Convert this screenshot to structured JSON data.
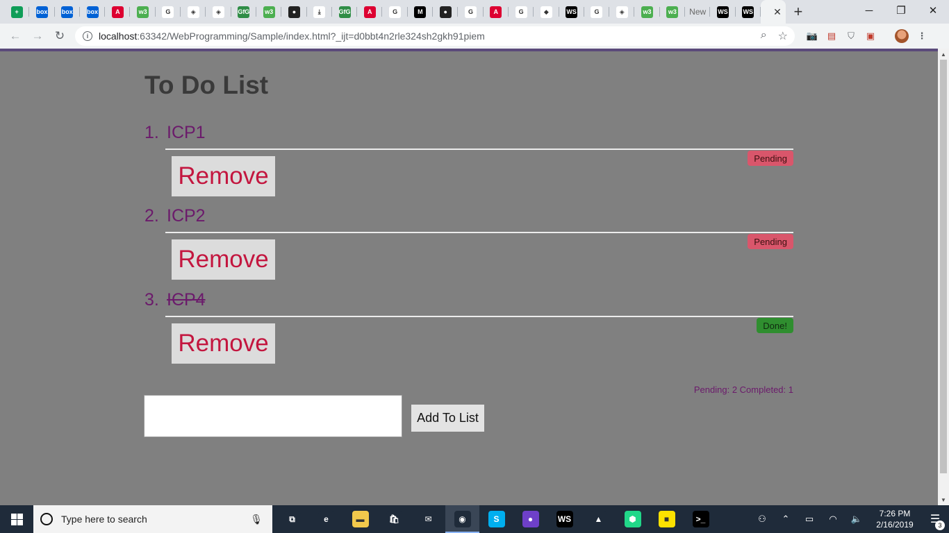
{
  "browser": {
    "tabs": [
      {
        "icon": "sheets-icon",
        "label": "",
        "color": "#0f9d58",
        "glyph": "+"
      },
      {
        "icon": "box-icon",
        "label": "",
        "color": "#0061d5",
        "glyph": "box"
      },
      {
        "icon": "box-icon",
        "label": "",
        "color": "#0061d5",
        "glyph": "box"
      },
      {
        "icon": "box-icon",
        "label": "",
        "color": "#0061d5",
        "glyph": "box"
      },
      {
        "icon": "angular-icon",
        "label": "",
        "color": "#dd0031",
        "glyph": "A"
      },
      {
        "icon": "w3schools-icon",
        "label": "",
        "color": "#4caf50",
        "glyph": "w3"
      },
      {
        "icon": "google-icon",
        "label": "",
        "color": "#ffffff",
        "glyph": "G"
      },
      {
        "icon": "codepen-icon",
        "label": "",
        "color": "#ffffff",
        "glyph": "◈"
      },
      {
        "icon": "codepen-icon",
        "label": "",
        "color": "#ffffff",
        "glyph": "◈"
      },
      {
        "icon": "gfg-icon",
        "label": "",
        "color": "#2f8d46",
        "glyph": "GfG"
      },
      {
        "icon": "w3schools-icon",
        "label": "",
        "color": "#4caf50",
        "glyph": "w3"
      },
      {
        "icon": "github-icon",
        "label": "",
        "color": "#222222",
        "glyph": "●"
      },
      {
        "icon": "download-icon",
        "label": "",
        "color": "#ffffff",
        "glyph": "⤓"
      },
      {
        "icon": "gfg-icon",
        "label": "",
        "color": "#2f8d46",
        "glyph": "GfG"
      },
      {
        "icon": "angular-icon",
        "label": "",
        "color": "#dd0031",
        "glyph": "A"
      },
      {
        "icon": "google-icon",
        "label": "",
        "color": "#ffffff",
        "glyph": "G"
      },
      {
        "icon": "medium-icon",
        "label": "",
        "color": "#000000",
        "glyph": "M"
      },
      {
        "icon": "github-icon",
        "label": "",
        "color": "#222222",
        "glyph": "●"
      },
      {
        "icon": "google-icon",
        "label": "",
        "color": "#ffffff",
        "glyph": "G"
      },
      {
        "icon": "angular-icon",
        "label": "",
        "color": "#dd0031",
        "glyph": "A"
      },
      {
        "icon": "google-icon",
        "label": "",
        "color": "#ffffff",
        "glyph": "G"
      },
      {
        "icon": "scrum-icon",
        "label": "",
        "color": "#ffffff",
        "glyph": "◆"
      },
      {
        "icon": "webstorm-icon",
        "label": "",
        "color": "#000000",
        "glyph": "WS"
      },
      {
        "icon": "google-icon",
        "label": "",
        "color": "#ffffff",
        "glyph": "G"
      },
      {
        "icon": "codepen-icon",
        "label": "",
        "color": "#ffffff",
        "glyph": "◈"
      },
      {
        "icon": "w3schools-icon",
        "label": "",
        "color": "#4caf50",
        "glyph": "w3"
      },
      {
        "icon": "w3schools-icon",
        "label": "",
        "color": "#4caf50",
        "glyph": "w3"
      },
      {
        "icon": "newtab-icon",
        "label": "New",
        "color": "",
        "glyph": ""
      },
      {
        "icon": "webstorm-icon",
        "label": "",
        "color": "#000000",
        "glyph": "WS"
      },
      {
        "icon": "webstorm-icon",
        "label": "",
        "color": "#000000",
        "glyph": "WS"
      }
    ],
    "url_host": "localhost",
    "url_path": ":63342/WebProgramming/Sample/index.html?_ijt=d0bbt4n2rle324sh2gkh91piem"
  },
  "app": {
    "title": "To Do List",
    "items": [
      {
        "number": "1.",
        "text": "ICP1",
        "status": "Pending",
        "done": false,
        "remove_label": "Remove"
      },
      {
        "number": "2.",
        "text": "ICP2",
        "status": "Pending",
        "done": false,
        "remove_label": "Remove"
      },
      {
        "number": "3.",
        "text": "ICP4",
        "status": "Done!",
        "done": true,
        "remove_label": "Remove"
      }
    ],
    "counts": "Pending: 2 Completed: 1",
    "input_value": "",
    "add_label": "Add To List"
  },
  "taskbar": {
    "search_placeholder": "Type here to search",
    "time": "7:26 PM",
    "date": "2/16/2019",
    "notification_count": "3",
    "apps": [
      {
        "icon": "task-view-icon",
        "color": "#1f2b3a",
        "glyph": "⧉"
      },
      {
        "icon": "edge-icon",
        "color": "#1f2b3a",
        "glyph": "e"
      },
      {
        "icon": "file-explorer-icon",
        "color": "#f2c94c",
        "glyph": "▬"
      },
      {
        "icon": "store-icon",
        "color": "#1f2b3a",
        "glyph": "🛍"
      },
      {
        "icon": "mail-icon",
        "color": "#1f2b3a",
        "glyph": "✉"
      },
      {
        "icon": "chrome-icon",
        "color": "#1f2b3a",
        "glyph": "◉"
      },
      {
        "icon": "skype-icon",
        "color": "#00aff0",
        "glyph": "S"
      },
      {
        "icon": "github-desktop-icon",
        "color": "#6e40c9",
        "glyph": "●"
      },
      {
        "icon": "webstorm-icon",
        "color": "#000000",
        "glyph": "WS"
      },
      {
        "icon": "sharkdoc-icon",
        "color": "#1f2b3a",
        "glyph": "▲"
      },
      {
        "icon": "pycharm-icon",
        "color": "#21d789",
        "glyph": "⬢"
      },
      {
        "icon": "sticky-notes-icon",
        "color": "#fce100",
        "glyph": "■"
      },
      {
        "icon": "terminal-icon",
        "color": "#000000",
        "glyph": ">_"
      }
    ]
  }
}
